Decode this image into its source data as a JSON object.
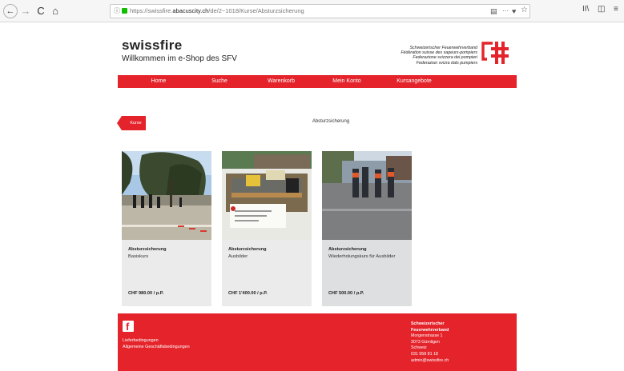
{
  "browser": {
    "url_prefix": "https://swissfire.",
    "url_domain": "abacuscity.ch",
    "url_path": "/de/2~1018/Kurse/Absturzsicherung",
    "info_glyph": "ⓘ",
    "nav_back": "←",
    "nav_forward": "→",
    "nav_reload": "C",
    "nav_home": "⌂",
    "more_glyph": "···",
    "star_glyph": "☆",
    "library_glyph": "II\\",
    "sidebar_glyph": "◫",
    "menu_glyph": "≡"
  },
  "header": {
    "title": "swissfire",
    "subtitle": "Willkommen im e-Shop des SFV",
    "org_lines": [
      "Schweizerischer Feuerwehrverband",
      "Fédération suisse des sapeurs-pompiers",
      "Federazione svizzera dei pompieri",
      "Federaziun svizra dals pumpiers"
    ]
  },
  "menu": [
    {
      "label": "Home"
    },
    {
      "label": "Suche"
    },
    {
      "label": "Warenkorb"
    },
    {
      "label": "Mein Konto"
    },
    {
      "label": "Kursangebote"
    }
  ],
  "back_button": {
    "label": "Kurse"
  },
  "page_heading": "Absturzsicherung",
  "products": [
    {
      "title": "Absturzsicherung",
      "subtitle": "Basiskurs",
      "price": "CHF 980.00 / p.P."
    },
    {
      "title": "Absturzsicherung",
      "subtitle": "Ausbilder",
      "price": "CHF 1'400.00 / p.P."
    },
    {
      "title": "Absturzsicherung",
      "subtitle": "Wiederholungskurs für Ausbilder",
      "price": "CHF 500.00 / p.P."
    }
  ],
  "footer": {
    "facebook_letter": "f",
    "links": [
      "Lieferbedingungen",
      "Allgemeine Geschäftsbedingungen"
    ],
    "address_name_1": "Schweizerischer",
    "address_name_2": "Feuerwehrverband",
    "street": "Morgenstrasse 1",
    "city": "3073 Gümligen",
    "country": "Schweiz",
    "phone": "031 958 81 18",
    "email": "admin@swissfire.ch"
  },
  "colors": {
    "brand_red": "#e4232b"
  }
}
